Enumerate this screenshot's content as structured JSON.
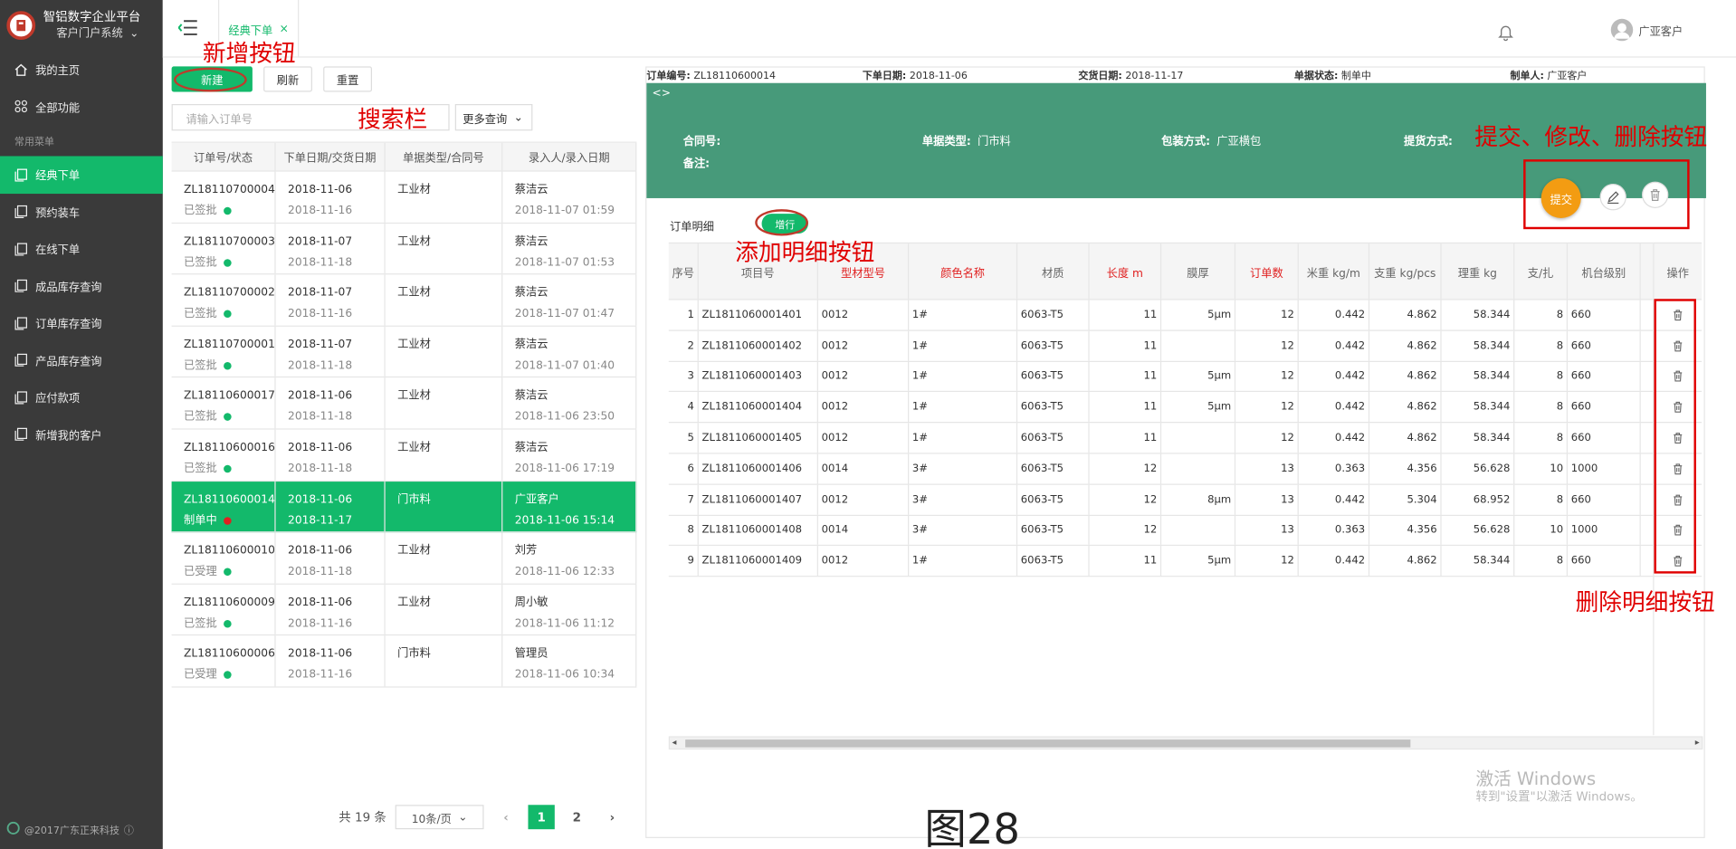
{
  "brand": {
    "title": "智铝数字企业平台",
    "subtitle": "客户门户系统"
  },
  "nav": {
    "home": "我的主页",
    "all": "全部功能",
    "section": "常用菜单",
    "items": [
      "经典下单",
      "预约装车",
      "在线下单",
      "成品库存查询",
      "订单库存查询",
      "产品库存查询",
      "应付款项",
      "新增我的客户"
    ]
  },
  "footer": {
    "copyright": "@2017广东正来科技"
  },
  "topbar": {
    "tab": "经典下单",
    "tab_close": "×",
    "user": "广亚客户"
  },
  "toolbar": {
    "new": "新建",
    "refresh": "刷新",
    "reset": "重置",
    "search_placeholder": "请输入订单号",
    "advanced": "更多查询"
  },
  "list": {
    "headers": [
      "订单号/状态",
      "下单日期/交货日期",
      "单据类型/合同号",
      "录入人/录入日期"
    ],
    "rows": [
      {
        "no": "ZL18110700004",
        "status": "已签批",
        "dot": "#13b96b",
        "d1": "2018-11-06",
        "d2": "2018-11-16",
        "type": "工业材",
        "user": "蔡洁云",
        "time": "2018-11-07 01:59"
      },
      {
        "no": "ZL18110700003",
        "status": "已签批",
        "dot": "#13b96b",
        "d1": "2018-11-07",
        "d2": "2018-11-18",
        "type": "工业材",
        "user": "蔡洁云",
        "time": "2018-11-07 01:53"
      },
      {
        "no": "ZL18110700002",
        "status": "已签批",
        "dot": "#13b96b",
        "d1": "2018-11-07",
        "d2": "2018-11-16",
        "type": "工业材",
        "user": "蔡洁云",
        "time": "2018-11-07 01:47"
      },
      {
        "no": "ZL18110700001",
        "status": "已签批",
        "dot": "#13b96b",
        "d1": "2018-11-07",
        "d2": "2018-11-18",
        "type": "工业材",
        "user": "蔡洁云",
        "time": "2018-11-07 01:40"
      },
      {
        "no": "ZL18110600017",
        "status": "已签批",
        "dot": "#13b96b",
        "d1": "2018-11-06",
        "d2": "2018-11-18",
        "type": "工业材",
        "user": "蔡洁云",
        "time": "2018-11-06 23:50"
      },
      {
        "no": "ZL18110600016",
        "status": "已签批",
        "dot": "#13b96b",
        "d1": "2018-11-06",
        "d2": "2018-11-18",
        "type": "工业材",
        "user": "蔡洁云",
        "time": "2018-11-06 17:19"
      },
      {
        "no": "ZL18110600014",
        "status": "制单中",
        "dot": "#e02020",
        "d1": "2018-11-06",
        "d2": "2018-11-17",
        "type": "门市料",
        "user": "广亚客户",
        "time": "2018-11-06 15:14"
      },
      {
        "no": "ZL18110600010",
        "status": "已受理",
        "dot": "#13b96b",
        "d1": "2018-11-06",
        "d2": "2018-11-18",
        "type": "工业材",
        "user": "刘芳",
        "time": "2018-11-06 12:33"
      },
      {
        "no": "ZL18110600009",
        "status": "已签批",
        "dot": "#13b96b",
        "d1": "2018-11-06",
        "d2": "2018-11-16",
        "type": "工业材",
        "user": "周小敏",
        "time": "2018-11-06 11:12"
      },
      {
        "no": "ZL18110600006",
        "status": "已受理",
        "dot": "#13b96b",
        "d1": "2018-11-06",
        "d2": "2018-11-16",
        "type": "门市料",
        "user": "管理员",
        "time": "2018-11-06 10:34"
      }
    ]
  },
  "pager": {
    "total": "共 19 条",
    "size": "10条/页",
    "pages": [
      "1",
      "2"
    ]
  },
  "order": {
    "no_label": "订单编号:",
    "no": "ZL18110600014",
    "date_label": "下单日期:",
    "date": "2018-11-06",
    "due_label": "交货日期:",
    "due": "2018-11-17",
    "status_label": "单据状态:",
    "status": "制单中",
    "maker_label": "制单人:",
    "maker": "广亚客户",
    "toggle": "<>",
    "contract_label": "合同号:",
    "contract": "",
    "type_label": "单据类型:",
    "type": "门市料",
    "pack_label": "包装方式:",
    "pack": "广亚横包",
    "pickup_label": "提货方式:",
    "pickup": "",
    "note_label": "备注:",
    "note": "",
    "submit": "提交",
    "detail_title": "订单明细",
    "add_row": "增行"
  },
  "detail": {
    "headers": [
      "序号",
      "项目号",
      "型材型号",
      "颜色名称",
      "材质",
      "长度 m",
      "膜厚",
      "订单数",
      "米重 kg/m",
      "支重 kg/pcs",
      "理重 kg",
      "支/扎",
      "机台级别"
    ],
    "red_headers": [
      2,
      3,
      5,
      7
    ],
    "op_header": "操作",
    "rows": [
      [
        "1",
        "ZL1811060001401",
        "0012",
        "1#",
        "6063-T5",
        "11",
        "5μm",
        "12",
        "0.442",
        "4.862",
        "58.344",
        "8",
        "660"
      ],
      [
        "2",
        "ZL1811060001402",
        "0012",
        "1#",
        "6063-T5",
        "11",
        "",
        "12",
        "0.442",
        "4.862",
        "58.344",
        "8",
        "660"
      ],
      [
        "3",
        "ZL1811060001403",
        "0012",
        "1#",
        "6063-T5",
        "11",
        "5μm",
        "12",
        "0.442",
        "4.862",
        "58.344",
        "8",
        "660"
      ],
      [
        "4",
        "ZL1811060001404",
        "0012",
        "1#",
        "6063-T5",
        "11",
        "5μm",
        "12",
        "0.442",
        "4.862",
        "58.344",
        "8",
        "660"
      ],
      [
        "5",
        "ZL1811060001405",
        "0012",
        "1#",
        "6063-T5",
        "11",
        "",
        "12",
        "0.442",
        "4.862",
        "58.344",
        "8",
        "660"
      ],
      [
        "6",
        "ZL1811060001406",
        "0014",
        "3#",
        "6063-T5",
        "12",
        "",
        "13",
        "0.363",
        "4.356",
        "56.628",
        "10",
        "1000"
      ],
      [
        "7",
        "ZL1811060001407",
        "0012",
        "3#",
        "6063-T5",
        "12",
        "8μm",
        "13",
        "0.442",
        "5.304",
        "68.952",
        "8",
        "660"
      ],
      [
        "8",
        "ZL1811060001408",
        "0014",
        "3#",
        "6063-T5",
        "12",
        "",
        "13",
        "0.363",
        "4.356",
        "56.628",
        "10",
        "1000"
      ],
      [
        "9",
        "ZL1811060001409",
        "0012",
        "1#",
        "6063-T5",
        "11",
        "5μm",
        "12",
        "0.442",
        "4.862",
        "58.344",
        "8",
        "660"
      ]
    ]
  },
  "annotations": {
    "new_btn": "新增按钮",
    "search": "搜索栏",
    "actions": "提交、修改、删除按钮",
    "add_detail": "添加明细按钮",
    "del_detail": "删除明细按钮"
  },
  "watermark": {
    "line1": "激活 Windows",
    "line2": "转到\"设置\"以激活 Windows。"
  },
  "figure": "图28",
  "colors": {
    "accent": "#13b96b",
    "header_green": "#479a7a",
    "submit": "#f39c12",
    "annotation": "#e00000"
  }
}
